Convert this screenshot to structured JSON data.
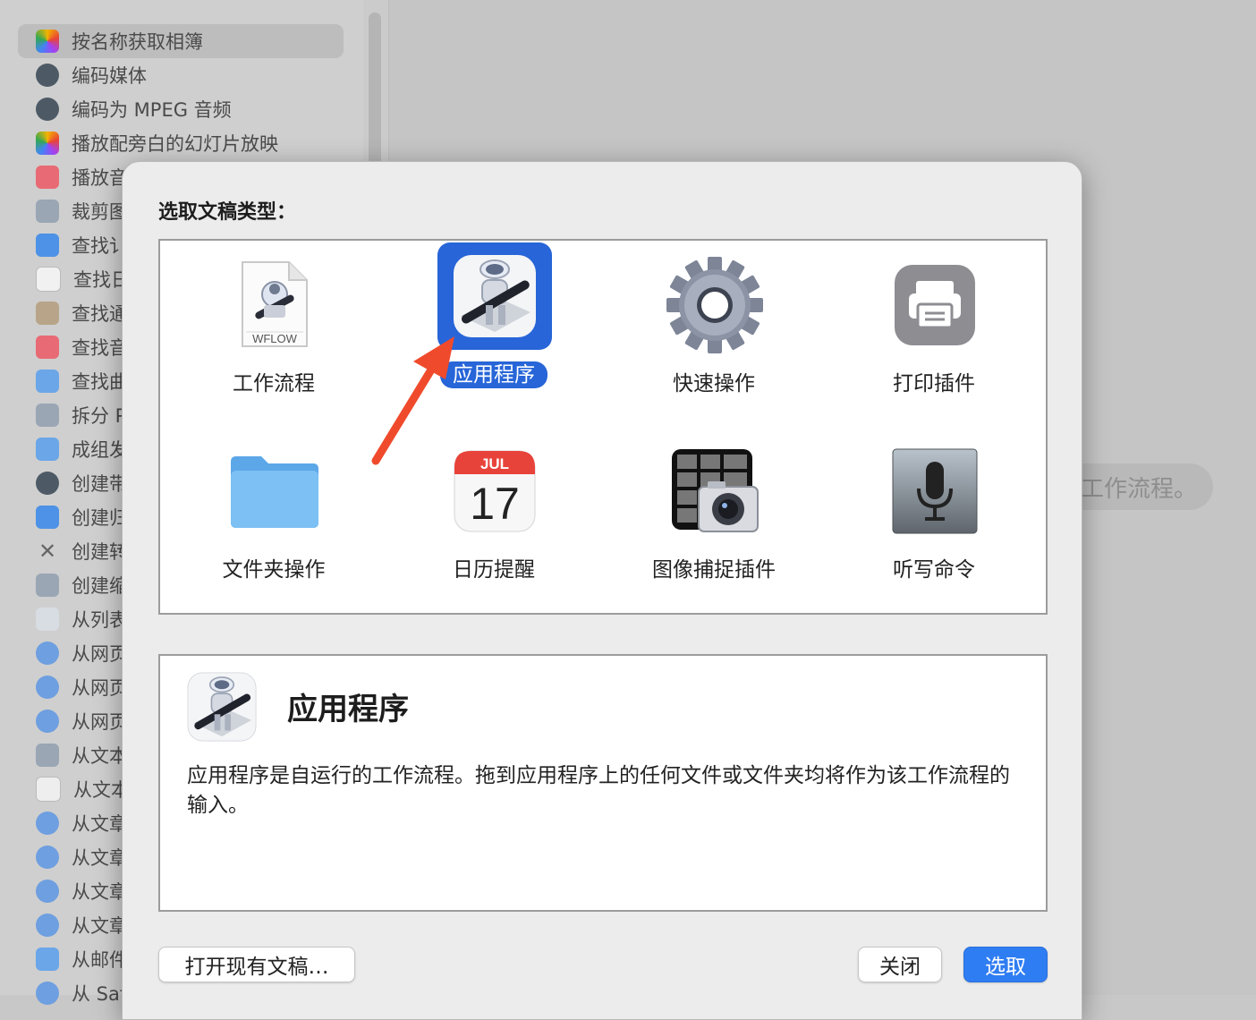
{
  "sidebar": {
    "items": [
      {
        "label": "按名称获取相簿",
        "icon": "photos-icon",
        "selected": true
      },
      {
        "label": "编码媒体",
        "icon": "quicktime-icon"
      },
      {
        "label": "编码为 MPEG 音频",
        "icon": "quicktime-icon"
      },
      {
        "label": "播放配旁白的幻灯片放映",
        "icon": "photos-icon"
      },
      {
        "label": "播放音",
        "icon": "music-icon"
      },
      {
        "label": "裁剪图",
        "icon": "preview-icon"
      },
      {
        "label": "查找讠",
        "icon": "finder-icon"
      },
      {
        "label": "查找日",
        "icon": "calendar-icon"
      },
      {
        "label": "查找通",
        "icon": "contacts-icon"
      },
      {
        "label": "查找音",
        "icon": "music-icon"
      },
      {
        "label": "查找曲",
        "icon": "mail-icon"
      },
      {
        "label": "拆分 P",
        "icon": "preview-icon"
      },
      {
        "label": "成组发",
        "icon": "mail-icon"
      },
      {
        "label": "创建带",
        "icon": "quicktime-icon"
      },
      {
        "label": "创建归",
        "icon": "finder-icon"
      },
      {
        "label": "创建转",
        "icon": "tools-icon"
      },
      {
        "label": "创建缩",
        "icon": "preview-icon"
      },
      {
        "label": "从列表",
        "icon": "automator-icon"
      },
      {
        "label": "从网页",
        "icon": "safari-icon"
      },
      {
        "label": "从网页",
        "icon": "safari-icon"
      },
      {
        "label": "从网页",
        "icon": "safari-icon"
      },
      {
        "label": "从文本",
        "icon": "preview-icon"
      },
      {
        "label": "从文本",
        "icon": "textedit-icon"
      },
      {
        "label": "从文章",
        "icon": "safari-icon"
      },
      {
        "label": "从文章",
        "icon": "safari-icon"
      },
      {
        "label": "从文章",
        "icon": "safari-icon"
      },
      {
        "label": "从文章",
        "icon": "safari-icon"
      },
      {
        "label": "从邮件",
        "icon": "mail-icon"
      },
      {
        "label": "从 Saf",
        "icon": "safari-icon"
      }
    ]
  },
  "background_hint": "工作流程。",
  "dialog": {
    "title": "选取文稿类型：",
    "types": [
      {
        "label": "工作流程",
        "icon": "workflow-file-icon",
        "badge": "WFLOW"
      },
      {
        "label": "应用程序",
        "icon": "automator-robot-icon",
        "selected": true
      },
      {
        "label": "快速操作",
        "icon": "gear-icon"
      },
      {
        "label": "打印插件",
        "icon": "printer-icon"
      },
      {
        "label": "文件夹操作",
        "icon": "folder-icon"
      },
      {
        "label": "日历提醒",
        "icon": "calendar-icon",
        "month": "JUL",
        "day": "17"
      },
      {
        "label": "图像捕捉插件",
        "icon": "image-capture-icon"
      },
      {
        "label": "听写命令",
        "icon": "microphone-icon"
      }
    ],
    "description": {
      "title": "应用程序",
      "text": "应用程序是自运行的工作流程。拖到应用程序上的任何文件或文件夹均将作为该工作流程的输入。"
    },
    "buttons": {
      "open": "打开现有文稿…",
      "close": "关闭",
      "choose": "选取"
    }
  },
  "colors": {
    "accent": "#2765d8",
    "primary_button": "#2f7df2",
    "arrow": "#f04a2c"
  }
}
